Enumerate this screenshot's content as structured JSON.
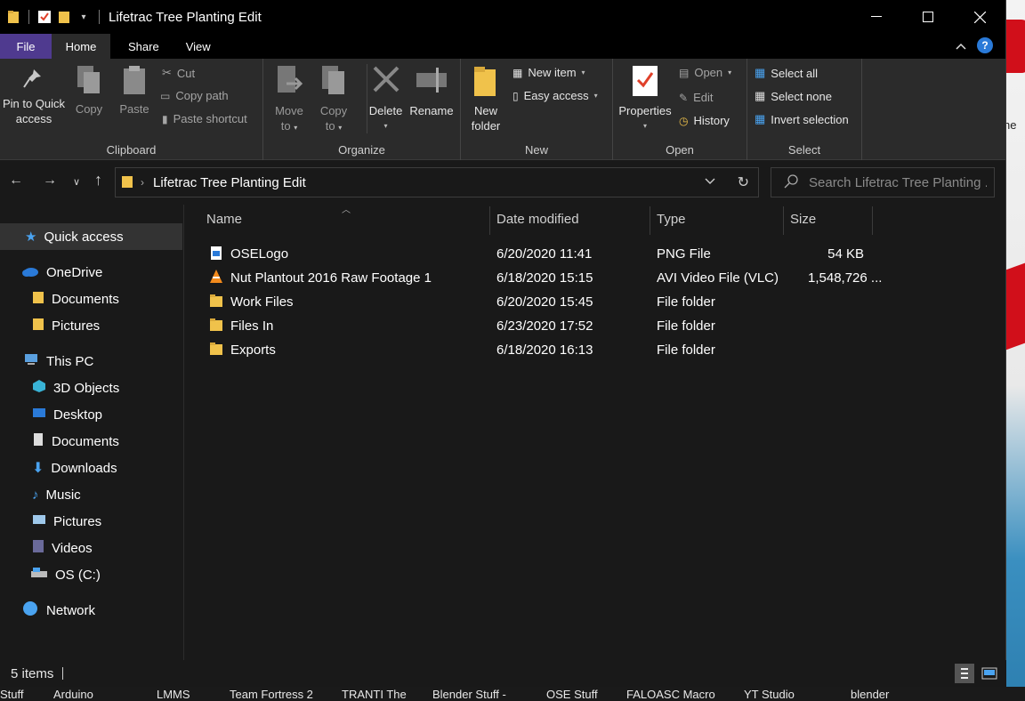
{
  "window": {
    "title": "Lifetrac Tree Planting Edit",
    "controls": [
      "minimize",
      "maximize",
      "close"
    ]
  },
  "ribbon_tabs": [
    "File",
    "Home",
    "Share",
    "View"
  ],
  "ribbon": {
    "clipboard": {
      "label": "Clipboard",
      "pin": "Pin to Quick",
      "pin2": "access",
      "copy": "Copy",
      "paste": "Paste",
      "cut": "Cut",
      "copy_path": "Copy path",
      "paste_shortcut": "Paste shortcut"
    },
    "organize": {
      "label": "Organize",
      "move": "Move",
      "move2": "to",
      "copyto": "Copy",
      "copyto2": "to",
      "delete": "Delete",
      "rename": "Rename"
    },
    "new": {
      "label": "New",
      "new_folder": "New",
      "new_folder2": "folder",
      "new_item": "New item",
      "easy_access": "Easy access"
    },
    "open": {
      "label": "Open",
      "properties": "Properties",
      "open": "Open",
      "edit": "Edit",
      "history": "History"
    },
    "select": {
      "label": "Select",
      "select_all": "Select all",
      "select_none": "Select none",
      "invert": "Invert selection"
    }
  },
  "address": {
    "path": "Lifetrac Tree Planting Edit",
    "search_placeholder": "Search Lifetrac Tree Planting ..."
  },
  "sidebar": {
    "quick_access": "Quick access",
    "onedrive": "OneDrive",
    "onedrive_children": [
      "Documents",
      "Pictures"
    ],
    "this_pc": "This PC",
    "pc_children": [
      "3D Objects",
      "Desktop",
      "Documents",
      "Downloads",
      "Music",
      "Pictures",
      "Videos",
      "OS (C:)"
    ],
    "network": "Network"
  },
  "columns": [
    "Name",
    "Date modified",
    "Type",
    "Size"
  ],
  "files": [
    {
      "name": "OSELogo",
      "date": "6/20/2020 11:41",
      "type": "PNG File",
      "size": "54 KB",
      "icon": "png-file-icon"
    },
    {
      "name": "Nut Plantout 2016 Raw Footage 1",
      "date": "6/18/2020 15:15",
      "type": "AVI Video File (VLC)",
      "size": "1,548,726 ...",
      "icon": "vlc-icon"
    },
    {
      "name": "Work Files",
      "date": "6/20/2020 15:45",
      "type": "File folder",
      "size": "",
      "icon": "folder-icon"
    },
    {
      "name": "Files In",
      "date": "6/23/2020 17:52",
      "type": "File folder",
      "size": "",
      "icon": "folder-icon"
    },
    {
      "name": "Exports",
      "date": "6/18/2020 16:13",
      "type": "File folder",
      "size": "",
      "icon": "folder-icon"
    }
  ],
  "status": {
    "items": "5 items"
  },
  "desktop": {
    "partial_label": "ne"
  },
  "taskbar": [
    "Stuff",
    "Arduino",
    "LMMS",
    "Team Fortress 2",
    "TRANTI The",
    "Blender Stuff -",
    "OSE Stuff",
    "FALOASC Macro",
    "YT Studio",
    "blender"
  ],
  "colors": {
    "window_bg": "#191919",
    "ribbon_bg": "#2b2b2b",
    "file_tab": "#4f3a8f",
    "folder_yellow": "#f0c24b",
    "accent_blue": "#2a7ad8"
  }
}
